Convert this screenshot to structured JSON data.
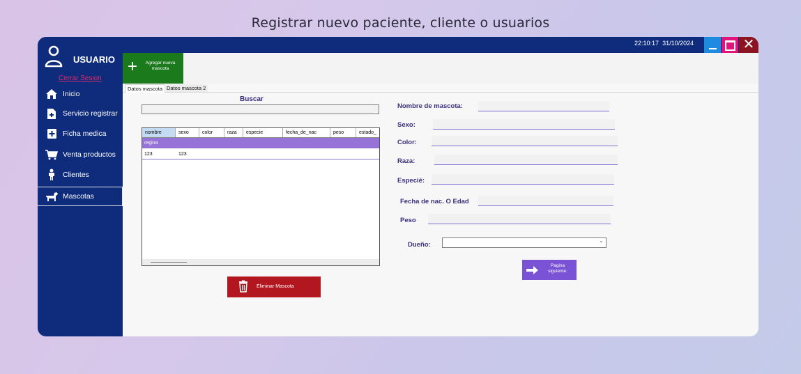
{
  "page": {
    "title": "Registrar nuevo paciente, cliente o usuarios"
  },
  "sidebar": {
    "user_label": "USUARIO",
    "logout_label": "Cerrar Sesion",
    "items": [
      {
        "label": "Inicio",
        "icon": "home-icon"
      },
      {
        "label": "Servicio registrar",
        "icon": "document-add-icon"
      },
      {
        "label": "Ficha medica",
        "icon": "medical-file-icon"
      },
      {
        "label": "Venta productos",
        "icon": "cart-icon"
      },
      {
        "label": "Clientes",
        "icon": "person-icon"
      },
      {
        "label": "Mascotas",
        "icon": "dog-icon",
        "active": true
      }
    ]
  },
  "titlebar": {
    "time": "22:10:17",
    "date": "31/10/2024"
  },
  "toolbar": {
    "add_pet_label": "Agregar nueva mascota"
  },
  "tabs": [
    {
      "label": "Datos mascota",
      "active": true
    },
    {
      "label": "Datos mascota 2",
      "active": false
    }
  ],
  "search": {
    "label": "Buscar",
    "value": ""
  },
  "table": {
    "columns": [
      "nombre",
      "sexo",
      "color",
      "raza",
      "especie",
      "fecha_de_nac",
      "peso",
      "estado_"
    ],
    "rows": [
      {
        "nombre": "regina",
        "sexo": ""
      },
      {
        "nombre": "123",
        "sexo": "123"
      }
    ]
  },
  "delete_button": {
    "label": "Eliminar Mascota"
  },
  "form": {
    "nombre_label": "Nombre de mascota:",
    "sexo_label": "Sexo:",
    "color_label": "Color:",
    "raza_label": "Raza:",
    "especie_label": "Especié:",
    "fecha_label": "Fecha de nac. O Edad",
    "peso_label": "Peso",
    "dueno_label": "Dueño:",
    "dueno_value": ""
  },
  "next_button": {
    "label": "Pagina siguiente:"
  },
  "colors": {
    "sidebar": "#0f2b7b",
    "add_button": "#1b7a1b",
    "delete_button": "#b2161e",
    "next_button": "#7a52d6",
    "selected_row": "#9673d6",
    "label_text": "#3a2f7c"
  }
}
